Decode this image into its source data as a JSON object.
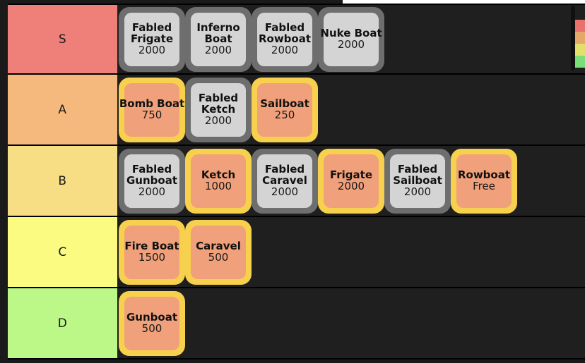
{
  "app": {
    "background_color": "#1a1a1a",
    "row_background_color": "#1f1f1f"
  },
  "card_styles": {
    "gray": {
      "border_color": "#6e6e6e",
      "fill_color": "#d4d4d4"
    },
    "gold": {
      "border_color": "#f7d04d",
      "fill_color": "#f0a07a"
    }
  },
  "tiers": [
    {
      "label": "S",
      "color": "#ef8079",
      "items": [
        {
          "name": "Fabled Frigate",
          "price": "2000",
          "style": "gray"
        },
        {
          "name": "Inferno Boat",
          "price": "2000",
          "style": "gray"
        },
        {
          "name": "Fabled Rowboat",
          "price": "2000",
          "style": "gray"
        },
        {
          "name": "Nuke Boat",
          "price": "2000",
          "style": "gray"
        }
      ]
    },
    {
      "label": "A",
      "color": "#f5b97d",
      "items": [
        {
          "name": "Bomb Boat",
          "price": "750",
          "style": "gold"
        },
        {
          "name": "Fabled Ketch",
          "price": "2000",
          "style": "gray"
        },
        {
          "name": "Sailboat",
          "price": "250",
          "style": "gold"
        }
      ]
    },
    {
      "label": "B",
      "color": "#f7dd83",
      "items": [
        {
          "name": "Fabled Gunboat",
          "price": "2000",
          "style": "gray"
        },
        {
          "name": "Ketch",
          "price": "1000",
          "style": "gold"
        },
        {
          "name": "Fabled Caravel",
          "price": "2000",
          "style": "gray"
        },
        {
          "name": "Frigate",
          "price": "2000",
          "style": "gold"
        },
        {
          "name": "Fabled Sailboat",
          "price": "2000",
          "style": "gray"
        },
        {
          "name": "Rowboat",
          "price": "Free",
          "style": "gold"
        }
      ]
    },
    {
      "label": "C",
      "color": "#fbfb82",
      "items": [
        {
          "name": "Fire Boat",
          "price": "1500",
          "style": "gold"
        },
        {
          "name": "Caravel",
          "price": "500",
          "style": "gold"
        }
      ]
    },
    {
      "label": "D",
      "color": "#bcf887",
      "items": [
        {
          "name": "Gunboat",
          "price": "500",
          "style": "gold"
        }
      ]
    }
  ],
  "palette": {
    "swatches": [
      "#e9716d",
      "#e3a86a",
      "#e0e06a",
      "#79de79"
    ]
  }
}
